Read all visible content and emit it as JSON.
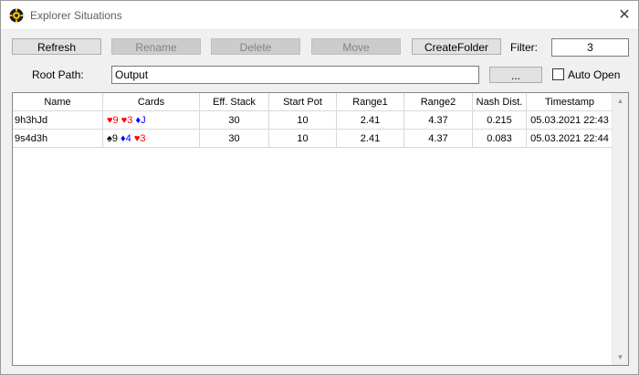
{
  "window": {
    "title": "Explorer Situations",
    "close_glyph": "✕"
  },
  "toolbar": {
    "refresh": "Refresh",
    "rename": "Rename",
    "delete": "Delete",
    "move": "Move",
    "create_folder": "CreateFolder",
    "filter_label": "Filter:",
    "filter_value": "3"
  },
  "root": {
    "label": "Root Path:",
    "value": "Output",
    "browse": "...",
    "auto_open_label": "Auto Open",
    "auto_open_checked": false
  },
  "table": {
    "columns": [
      "Name",
      "Cards",
      "Eff. Stack",
      "Start Pot",
      "Range1",
      "Range2",
      "Nash Dist.",
      "Timestamp"
    ],
    "rows": [
      {
        "name": "9h3hJd",
        "cards": [
          {
            "suit": "♥",
            "rank": "9",
            "color": "#ff0000"
          },
          {
            "suit": "♥",
            "rank": "3",
            "color": "#ff0000"
          },
          {
            "suit": "♦",
            "rank": "J",
            "color": "#0000ff"
          }
        ],
        "eff_stack": "30",
        "start_pot": "10",
        "range1": "2.41",
        "range2": "4.37",
        "nash_dist": "0.215",
        "timestamp": "05.03.2021 22:43"
      },
      {
        "name": "9s4d3h",
        "cards": [
          {
            "suit": "♠",
            "rank": "9",
            "color": "#000000"
          },
          {
            "suit": "♦",
            "rank": "4",
            "color": "#0000ff"
          },
          {
            "suit": "♥",
            "rank": "3",
            "color": "#ff0000"
          }
        ],
        "eff_stack": "30",
        "start_pot": "10",
        "range1": "2.41",
        "range2": "4.37",
        "nash_dist": "0.083",
        "timestamp": "05.03.2021 22:44"
      }
    ]
  }
}
